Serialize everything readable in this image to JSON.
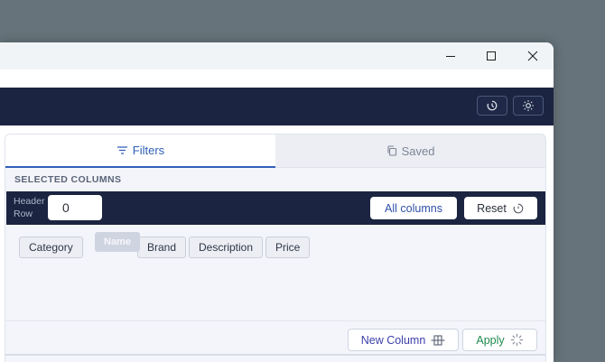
{
  "window": {
    "controls": {
      "minimize": "minimize",
      "maximize": "maximize",
      "close": "close"
    }
  },
  "header": {
    "buttons": [
      {
        "icon": "history-icon"
      },
      {
        "icon": "theme-toggle-icon"
      }
    ]
  },
  "tabs": [
    {
      "label": "Filters",
      "icon": "filter-lines-icon",
      "active": true
    },
    {
      "label": "Saved",
      "icon": "copy-icon",
      "active": false
    }
  ],
  "section_title": "SELECTED COLUMNS",
  "header_row": {
    "label_line1": "Header",
    "label_line2": "Row",
    "value": "0"
  },
  "toolbar": {
    "all_columns_label": "All columns",
    "reset_label": "Reset"
  },
  "columns": [
    "Category",
    "Brand",
    "Description",
    "Price"
  ],
  "dragging_chip": "Name",
  "footer": {
    "new_column_label": "New Column",
    "apply_label": "Apply"
  },
  "colors": {
    "header_bg": "#1b2440",
    "accent_blue": "#2f5fb7",
    "apply_green": "#1f8a4c",
    "new_column_blue": "#3a3fa8"
  }
}
